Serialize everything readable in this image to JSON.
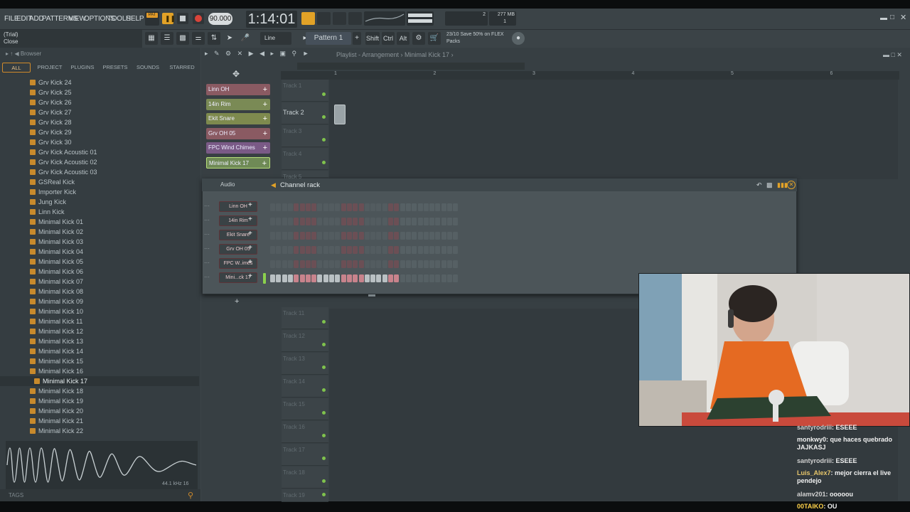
{
  "menu": [
    "FILE",
    "EDIT",
    "ADD",
    "PATTERNS",
    "VIEW",
    "OPTIONS",
    "TOOLS",
    "HELP"
  ],
  "transport": {
    "mode": "PAT",
    "tempo": "90.000",
    "time": "1:14:01",
    "cpu": "2",
    "ram": "277 MB",
    "poly": "1"
  },
  "hint": {
    "line1": "(Trial)",
    "line2": "Close"
  },
  "toolbar": {
    "snap": "Line",
    "pattern": "Pattern 1",
    "shift": "Shift",
    "ctrl": "Ctrl",
    "alt": "Alt",
    "news_line1": "23/10  Save 50% on FLEX",
    "news_line2": "Packs"
  },
  "browser": {
    "title": "Browser",
    "tabs": [
      "ALL",
      "PROJECT",
      "PLUGINS",
      "PRESETS",
      "SOUNDS",
      "STARRED"
    ],
    "items": [
      "Grv Kick 24",
      "Grv Kick 25",
      "Grv Kick 26",
      "Grv Kick 27",
      "Grv Kick 28",
      "Grv Kick 29",
      "Grv Kick 30",
      "Grv Kick Acoustic 01",
      "Grv Kick Acoustic 02",
      "Grv Kick Acoustic 03",
      "GSReal Kick",
      "Importer Kick",
      "Jung Kick",
      "Linn Kick",
      "Minimal Kick 01",
      "Minimal Kick 02",
      "Minimal Kick 03",
      "Minimal Kick 04",
      "Minimal Kick 05",
      "Minimal Kick 06",
      "Minimal Kick 07",
      "Minimal Kick 08",
      "Minimal Kick 09",
      "Minimal Kick 10",
      "Minimal Kick 11",
      "Minimal Kick 12",
      "Minimal Kick 13",
      "Minimal Kick 14",
      "Minimal Kick 15",
      "Minimal Kick 16",
      "Minimal Kick 17",
      "Minimal Kick 18",
      "Minimal Kick 19",
      "Minimal Kick 20",
      "Minimal Kick 21",
      "Minimal Kick 22"
    ],
    "selected": "Minimal Kick 17",
    "sample_rate": "44.1 kHz 16",
    "tags_label": "TAGS"
  },
  "playlist": {
    "title": "Playlist - Arrangement",
    "arrangement": "Minimal Kick 17",
    "patterns": [
      {
        "name": "Linn OH",
        "color": "#8a5a62"
      },
      {
        "name": "14in Rim",
        "color": "#7a8a55"
      },
      {
        "name": "Ekit Snare",
        "color": "#7e8a4e"
      },
      {
        "name": "Grv OH 05",
        "color": "#8a5a62"
      },
      {
        "name": "FPC Wind Chimes",
        "color": "#7a5a86"
      },
      {
        "name": "Minimal Kick 17",
        "color": "#6f8a56"
      }
    ],
    "ruler": [
      "1",
      "2",
      "3",
      "4",
      "5",
      "6"
    ],
    "tracks_top": [
      "Track 1",
      "Track 2",
      "Track 3",
      "Track 4",
      "Track 5"
    ],
    "tracks_bottom": [
      "Track 11",
      "Track 12",
      "Track 13",
      "Track 14",
      "Track 15",
      "Track 16",
      "Track 17",
      "Track 18",
      "Track 19"
    ]
  },
  "channel_rack": {
    "title": "Channel rack",
    "group": "Audio",
    "channels": [
      {
        "name": "Linn OH",
        "steps": 0
      },
      {
        "name": "14in Rim",
        "steps": 0
      },
      {
        "name": "Ekit Snare",
        "steps": 0
      },
      {
        "name": "Grv OH 05",
        "steps": 0
      },
      {
        "name": "FPC W..imes",
        "steps": 0
      },
      {
        "name": "Mini...ck 17",
        "steps": 1
      }
    ],
    "add_label": "+"
  },
  "chat": [
    {
      "user": "santyrodriii",
      "msg": "ESEEE",
      "user_color": "#d0d0d0"
    },
    {
      "user": "monkwy0",
      "msg": "que haces quebrado JAJKASJ",
      "user_color": "#f2f2f2"
    },
    {
      "user": "santyrodriii",
      "msg": "ESEEE",
      "user_color": "#d0d0d0"
    },
    {
      "user": "Luis_Alex7",
      "msg": "mejor cierra el live pendejo",
      "user_color": "#e6c56a"
    },
    {
      "user": "alamv201",
      "msg": "ooooou",
      "user_color": "#d0d0d0"
    },
    {
      "user": "00TAIKO",
      "msg": "OU",
      "user_color": "#ffd24a"
    }
  ]
}
